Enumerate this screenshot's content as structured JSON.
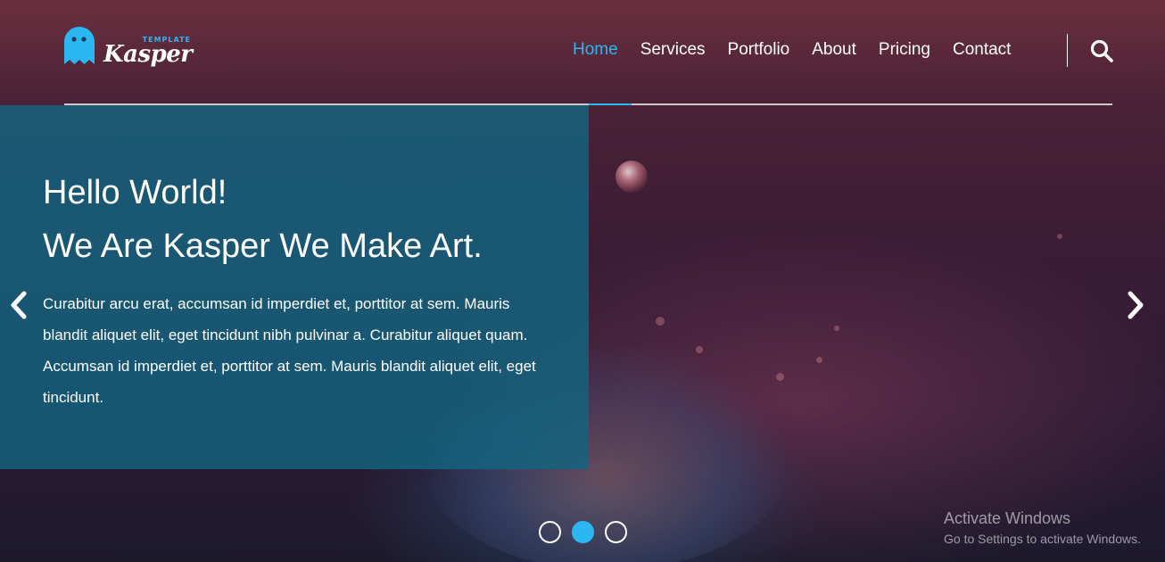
{
  "brand": {
    "logo_small": "TEMPLATE",
    "logo_word": "Kasper",
    "accent_color": "#2bb7f1"
  },
  "nav": {
    "items": [
      {
        "label": "Home",
        "active": true
      },
      {
        "label": "Services",
        "active": false
      },
      {
        "label": "Portfolio",
        "active": false
      },
      {
        "label": "About",
        "active": false
      },
      {
        "label": "Pricing",
        "active": false
      },
      {
        "label": "Contact",
        "active": false
      }
    ],
    "search_icon": "search-icon"
  },
  "hero": {
    "headline_line1": "Hello World!",
    "headline_line2": "We Are Kasper We Make Art.",
    "body": "Curabitur arcu erat, accumsan id imperdiet et, porttitor at sem. Mauris blandit aliquet elit, eget tincidunt nibh pulvinar a. Curabitur aliquet quam. Accumsan id imperdiet et, porttitor at sem. Mauris blandit aliquet elit, eget tincidunt.",
    "prev_icon": "chevron-left-icon",
    "next_icon": "chevron-right-icon",
    "slides": {
      "count": 3,
      "active_index": 1
    }
  },
  "watermark": {
    "title": "Activate Windows",
    "subtitle": "Go to Settings to activate Windows."
  }
}
